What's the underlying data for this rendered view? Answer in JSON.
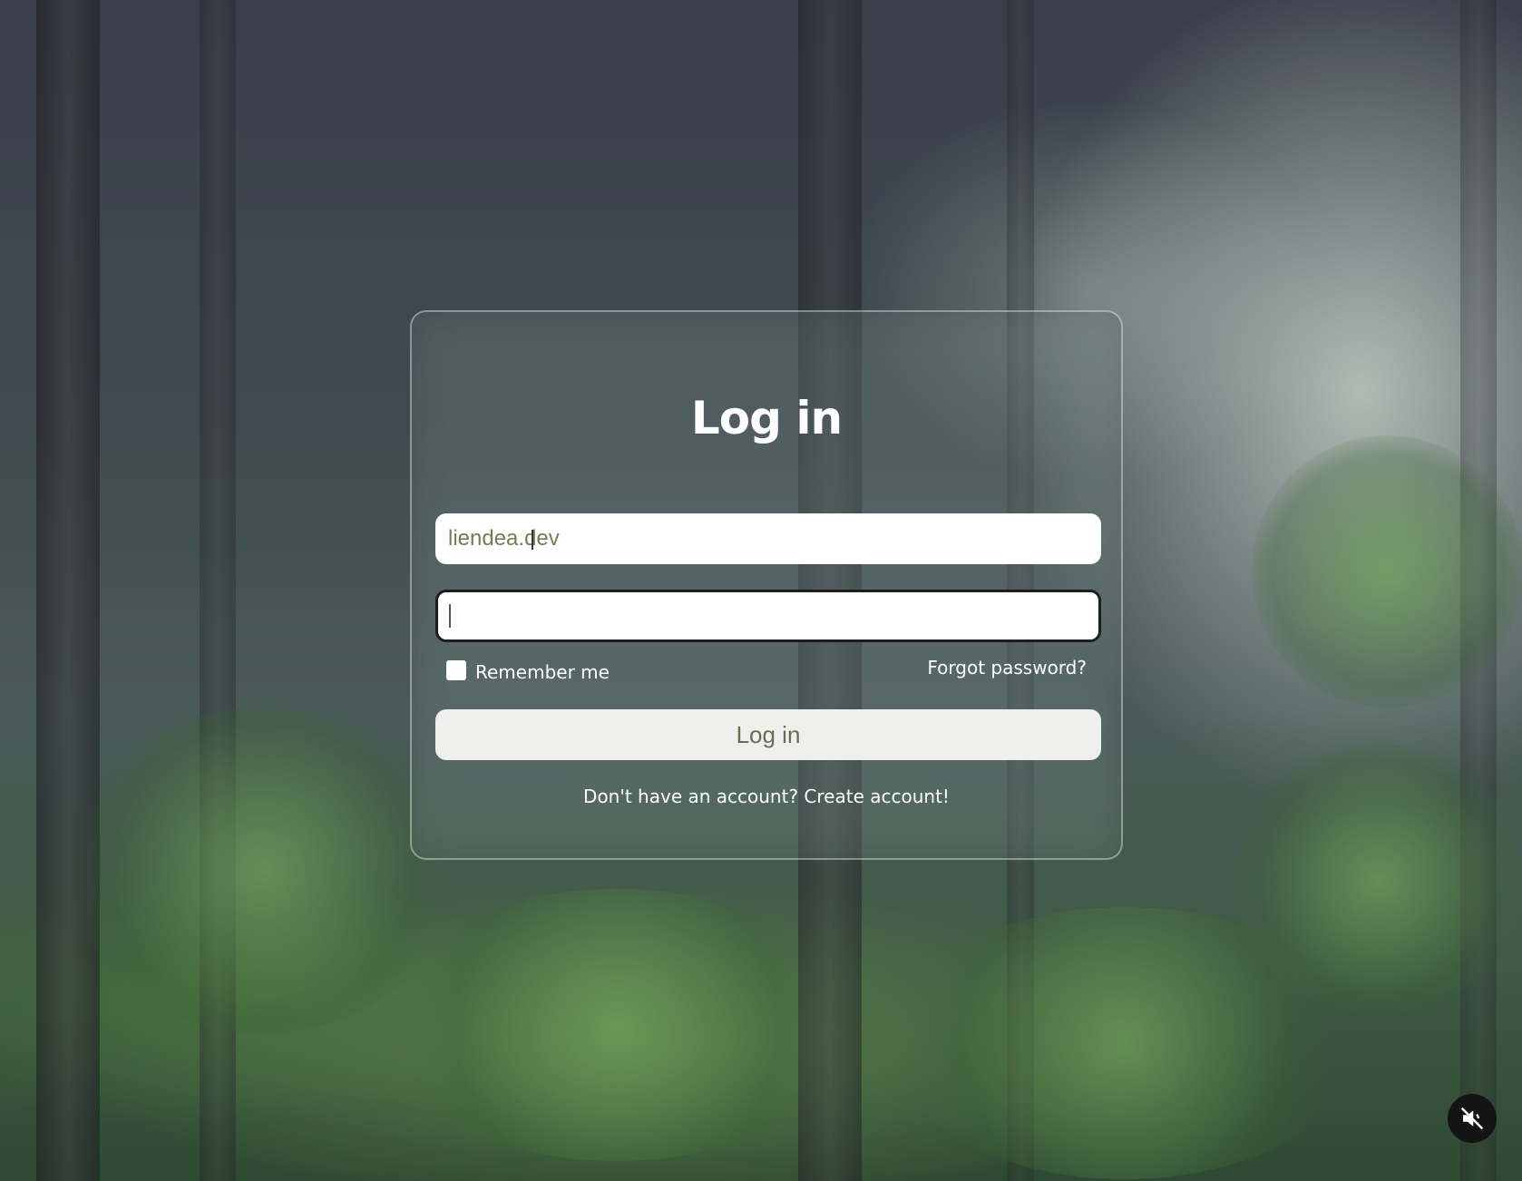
{
  "login_card": {
    "title": "Log in",
    "username_value": "liendea.dev",
    "password_value": "",
    "remember_label": "Remember me",
    "forgot_password_label": "Forgot password?",
    "login_button_label": "Log in",
    "signup_prompt": "Don't have an account? Create account!"
  },
  "media_controls": {
    "mute_icon": "speaker-muted-icon"
  },
  "colors": {
    "card_border": "#ffffff",
    "button_bg": "#efefed",
    "input_focus_border": "#1d1d1d"
  }
}
